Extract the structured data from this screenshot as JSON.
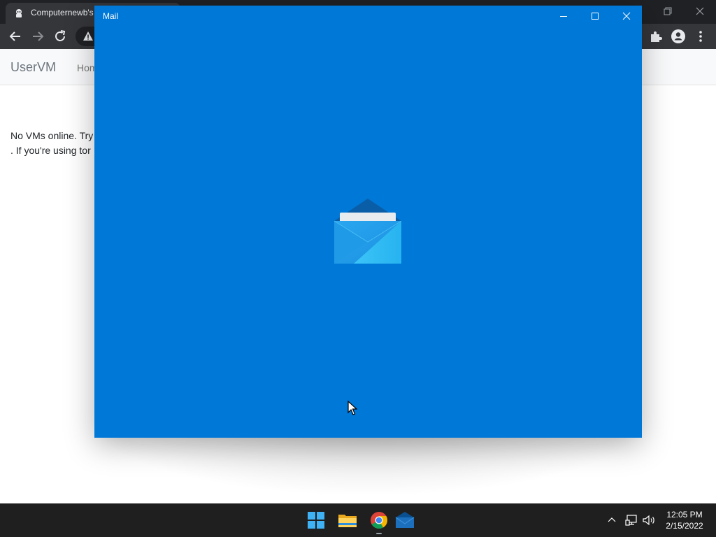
{
  "browser": {
    "tab_title": "Computernewb's",
    "toolbar_icons": [
      "back-arrow-icon",
      "forward-arrow-icon",
      "reload-icon",
      "warning-icon",
      "extensions-icon",
      "profile-icon",
      "more-menu-icon"
    ],
    "window_controls": [
      "restore-icon",
      "close-icon"
    ]
  },
  "site": {
    "brand": "UserVM",
    "nav_home": "Hom",
    "message_line1": "No VMs online. Try",
    "message_line2": ". If you're using tor"
  },
  "mail_window": {
    "title": "Mail",
    "background_color": "#0078d7",
    "controls": [
      "minimize-icon",
      "maximize-icon",
      "close-icon"
    ],
    "splash_icon": "mail-envelope-icon"
  },
  "taskbar": {
    "apps": [
      "windows-start-icon",
      "file-explorer-icon",
      "chrome-icon",
      "mail-icon"
    ],
    "tray_icons": [
      "chevron-up-icon",
      "network-icon",
      "volume-icon"
    ],
    "time": "12:05 PM",
    "date": "2/15/2022"
  }
}
